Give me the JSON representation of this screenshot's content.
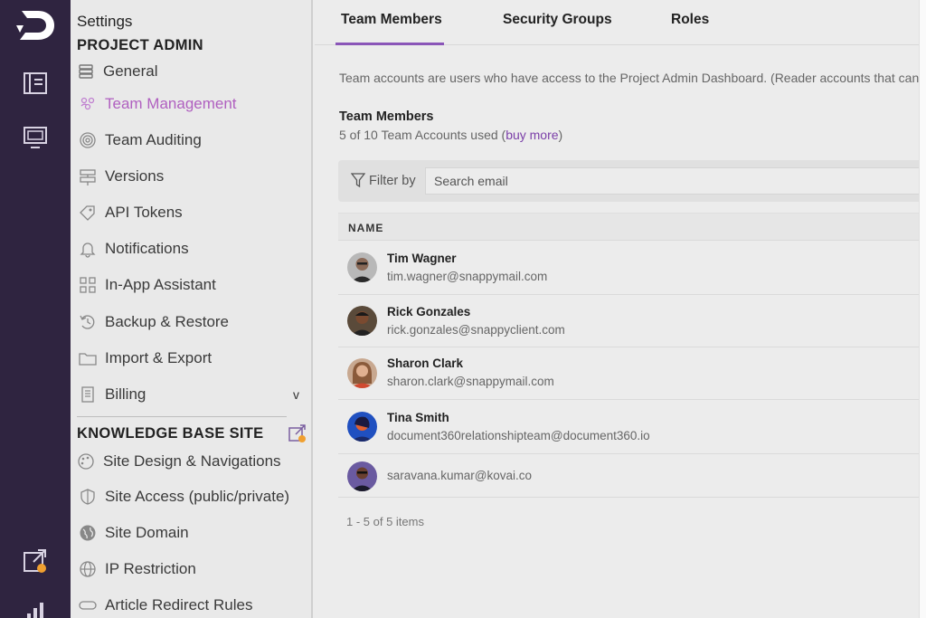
{
  "sidebar": {
    "title": "Settings",
    "section_project": "PROJECT ADMIN",
    "items": [
      {
        "label": "General",
        "icon": "database-icon"
      },
      {
        "label": "Team Management",
        "icon": "team-icon",
        "active": true
      },
      {
        "label": "Team Auditing",
        "icon": "fingerprint-icon"
      },
      {
        "label": "Versions",
        "icon": "signpost-icon"
      },
      {
        "label": "API Tokens",
        "icon": "tag-icon"
      },
      {
        "label": "Notifications",
        "icon": "bell-icon"
      },
      {
        "label": "In-App Assistant",
        "icon": "grid-icon"
      },
      {
        "label": "Backup & Restore",
        "icon": "restore-icon"
      },
      {
        "label": "Import & Export",
        "icon": "folder-icon"
      },
      {
        "label": "Billing",
        "icon": "document-icon"
      }
    ],
    "billing_chevron": "v",
    "section_kb": "KNOWLEDGE BASE SITE",
    "kb_items": [
      {
        "label": "Site Design & Navigations",
        "icon": "palette-icon"
      },
      {
        "label": "Site Access (public/private)",
        "icon": "shield-icon"
      },
      {
        "label": "Site Domain",
        "icon": "globe-icon"
      },
      {
        "label": "IP Restriction",
        "icon": "ip-globe-icon"
      },
      {
        "label": "Article Redirect Rules",
        "icon": "redirect-icon"
      }
    ]
  },
  "tabs": {
    "team_members": "Team Members",
    "security_groups": "Security Groups",
    "roles": "Roles"
  },
  "main": {
    "description": "Team accounts are users who have access to the Project Admin Dashboard. (Reader accounts that can",
    "heading": "Team Members",
    "usage_prefix": "5 of 10 Team Accounts used (",
    "buy_more": "buy more",
    "usage_suffix": ")",
    "filter_label": "Filter by",
    "search_placeholder": "Search email",
    "column_name": "NAME",
    "pager": "1 - 5 of 5 items"
  },
  "members": [
    {
      "name": "Tim Wagner",
      "email": "tim.wagner@snappymail.com"
    },
    {
      "name": "Rick Gonzales",
      "email": "rick.gonzales@snappyclient.com"
    },
    {
      "name": "Sharon Clark",
      "email": "sharon.clark@snappymail.com"
    },
    {
      "name": "Tina Smith",
      "email": "document360relationshipteam@document360.io"
    },
    {
      "name": "",
      "email": "saravana.kumar@kovai.co"
    }
  ],
  "colors": {
    "rail": "#2f2440",
    "accent": "#8a55b8",
    "active_text": "#b060c0",
    "link": "#7b3fa8"
  }
}
